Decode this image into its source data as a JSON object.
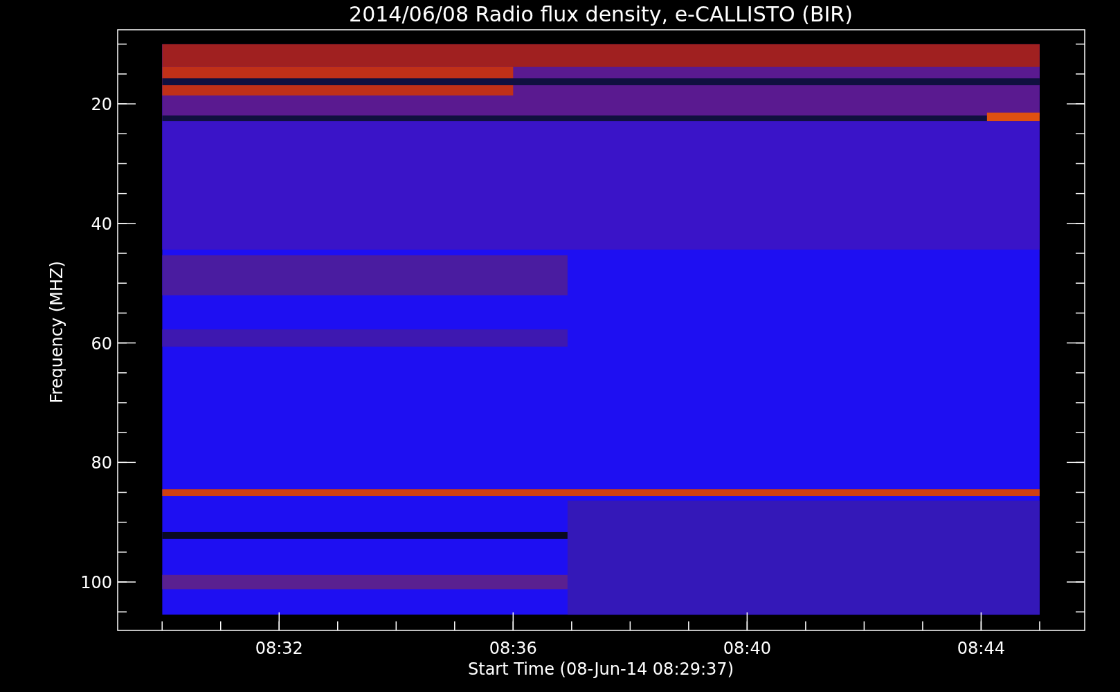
{
  "title": "2014/06/08  Radio flux density, e-CALLISTO (BIR)",
  "y_axis": {
    "label": "Frequency (MHZ)",
    "ticks": [
      {
        "label": "20"
      },
      {
        "label": "40"
      },
      {
        "label": "60"
      },
      {
        "label": "80"
      },
      {
        "label": "100"
      }
    ]
  },
  "x_axis": {
    "label": "Start Time (08-Jun-14 08:29:37)",
    "ticks": [
      {
        "label": "08:32"
      },
      {
        "label": "08:36"
      },
      {
        "label": "08:40"
      },
      {
        "label": "08:44"
      }
    ]
  }
}
